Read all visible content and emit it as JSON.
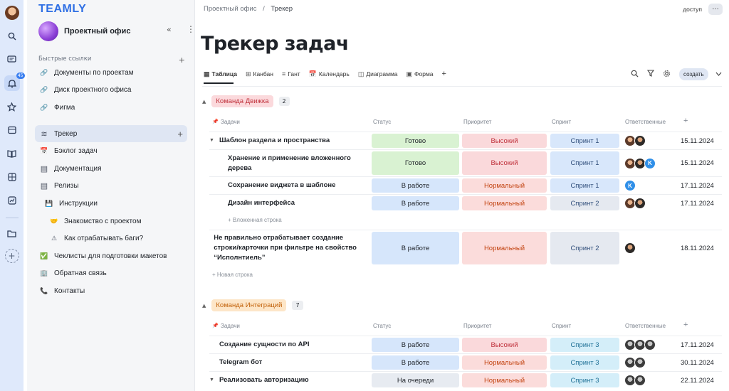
{
  "rail": {
    "icons": [
      "avatar",
      "search-icon",
      "chat-icon",
      "bell-icon",
      "star-icon",
      "inbox-icon",
      "book-icon",
      "apps-icon",
      "chart-icon",
      "folder-icon"
    ],
    "notification_badge": "45"
  },
  "sidebar": {
    "logo": "TEAMLY",
    "space_name": "Проектный офис",
    "quick_links_title": "Быстрые ссылки",
    "quick_links": [
      {
        "label": "Документы по проектам",
        "icon": "link-icon"
      },
      {
        "label": "Диск проектного офиса",
        "icon": "link-icon"
      },
      {
        "label": "Фигма",
        "icon": "link-icon"
      }
    ],
    "items": [
      {
        "label": "Трекер",
        "icon": "database-icon"
      },
      {
        "label": "Бэклог задач",
        "icon": "calendar-icon"
      },
      {
        "label": "Документация",
        "icon": "document-icon"
      },
      {
        "label": "Релизы",
        "icon": "document-icon"
      },
      {
        "label": "Инструкции",
        "icon": "floppy-icon"
      },
      {
        "label": "Знакомство с проектом",
        "icon": "handshake-icon"
      },
      {
        "label": "Как отрабатывать баги?",
        "icon": "warning-icon"
      },
      {
        "label": "Чеклисты для подготовки макетов",
        "icon": "checkmark-icon"
      },
      {
        "label": "Обратная связь",
        "icon": "building-icon"
      },
      {
        "label": "Контакты",
        "icon": "phone-icon"
      }
    ]
  },
  "header": {
    "breadcrumb_root": "Проектный офис",
    "breadcrumb_sep": "/",
    "breadcrumb_current": "Трекер",
    "access": "доступ",
    "more": "···",
    "title": "Трекер задач"
  },
  "views": [
    {
      "label": "Таблица",
      "icon": "table-icon"
    },
    {
      "label": "Канбан",
      "icon": "kanban-icon"
    },
    {
      "label": "Гант",
      "icon": "gantt-icon"
    },
    {
      "label": "Календарь",
      "icon": "calendar-icon"
    },
    {
      "label": "Диаграмма",
      "icon": "diagram-icon"
    },
    {
      "label": "Форма",
      "icon": "form-icon"
    }
  ],
  "toolbar": {
    "create": "создать"
  },
  "columns": {
    "task": "Задачи",
    "status": "Статус",
    "priority": "Приоритет",
    "sprint": "Спринт",
    "owner": "Ответственные"
  },
  "colors": {
    "done": "#d9f2d2",
    "in_work": "#d6e6fb",
    "queued": "#e7ebf1",
    "high": "#fad9db",
    "normal": "#fbdcdb",
    "sprint_blue": "#d8e7fb",
    "sprint_grey": "#e5e9f0",
    "sprint_cyan": "#d4eef9"
  },
  "groups": [
    {
      "name": "Команда Движка",
      "count": "2",
      "color": "#fbd9dc",
      "text_color": "#c0333d",
      "add_nested": "Вложенная строка",
      "add_row": "Новая строка",
      "rows": [
        {
          "task": "Шаблон раздела и пространства",
          "expand": "▼",
          "status": "Готово",
          "status_key": "done",
          "priority": "Высокий",
          "sprint": "Спринт 1",
          "sprint_key": "sprint_blue",
          "avatars": [
            "p1",
            "p2"
          ],
          "date": "15.11.2024"
        },
        {
          "task": "Хранение и применение вложенного дерева",
          "sub": true,
          "status": "Готово",
          "status_key": "done",
          "priority": "Высокий",
          "sprint": "Спринт 1",
          "sprint_key": "sprint_blue",
          "avatars": [
            "p1",
            "p2",
            "k"
          ],
          "date": "15.11.2024"
        },
        {
          "task": "Сохранение виджета в шаблоне",
          "sub": true,
          "status": "В работе",
          "status_key": "in_work",
          "priority": "Нормальный",
          "sprint": "Спринт 1",
          "sprint_key": "sprint_blue",
          "avatars": [
            "k"
          ],
          "date": "17.11.2024"
        },
        {
          "task": "Дизайн интерфейса",
          "sub": true,
          "status": "В работе",
          "status_key": "in_work",
          "priority": "Нормальный",
          "sprint": "Спринт 2",
          "sprint_key": "sprint_grey",
          "avatars": [
            "p1",
            "p2"
          ],
          "date": "17.11.2024"
        },
        {
          "task": "Не правильно отрабатывает создание строки/карточки при фильтре на свойство “Исполнтиель”",
          "status": "В работе",
          "status_key": "in_work",
          "priority": "Нормальный",
          "sprint": "Спринт 2",
          "sprint_key": "sprint_grey",
          "avatars": [
            "p2"
          ],
          "date": "18.11.2024"
        }
      ]
    },
    {
      "name": "Команда  Интеграций",
      "count": "7",
      "color": "#fde6c8",
      "text_color": "#c2620a",
      "rows": [
        {
          "task": "Создание сущности по API",
          "status": "В работе",
          "status_key": "in_work",
          "priority": "Высокий",
          "sprint": "Спринт 3",
          "sprint_key": "sprint_cyan",
          "avatars": [
            "p3",
            "p3",
            "p3"
          ],
          "date": "17.11.2024"
        },
        {
          "task": "Telegram бот",
          "status": "В работе",
          "status_key": "in_work",
          "priority": "Нормальный",
          "sprint": "Спринт 3",
          "sprint_key": "sprint_cyan",
          "avatars": [
            "p3",
            "p3"
          ],
          "date": "30.11.2024"
        },
        {
          "task": "Реализовать авторизацию",
          "expand": "▼",
          "status": "На очереди",
          "status_key": "queued",
          "priority": "Нормальный",
          "sprint": "Спринт 3",
          "sprint_key": "sprint_cyan",
          "avatars": [
            "p3",
            "p3"
          ],
          "date": "22.11.2024"
        }
      ]
    }
  ]
}
